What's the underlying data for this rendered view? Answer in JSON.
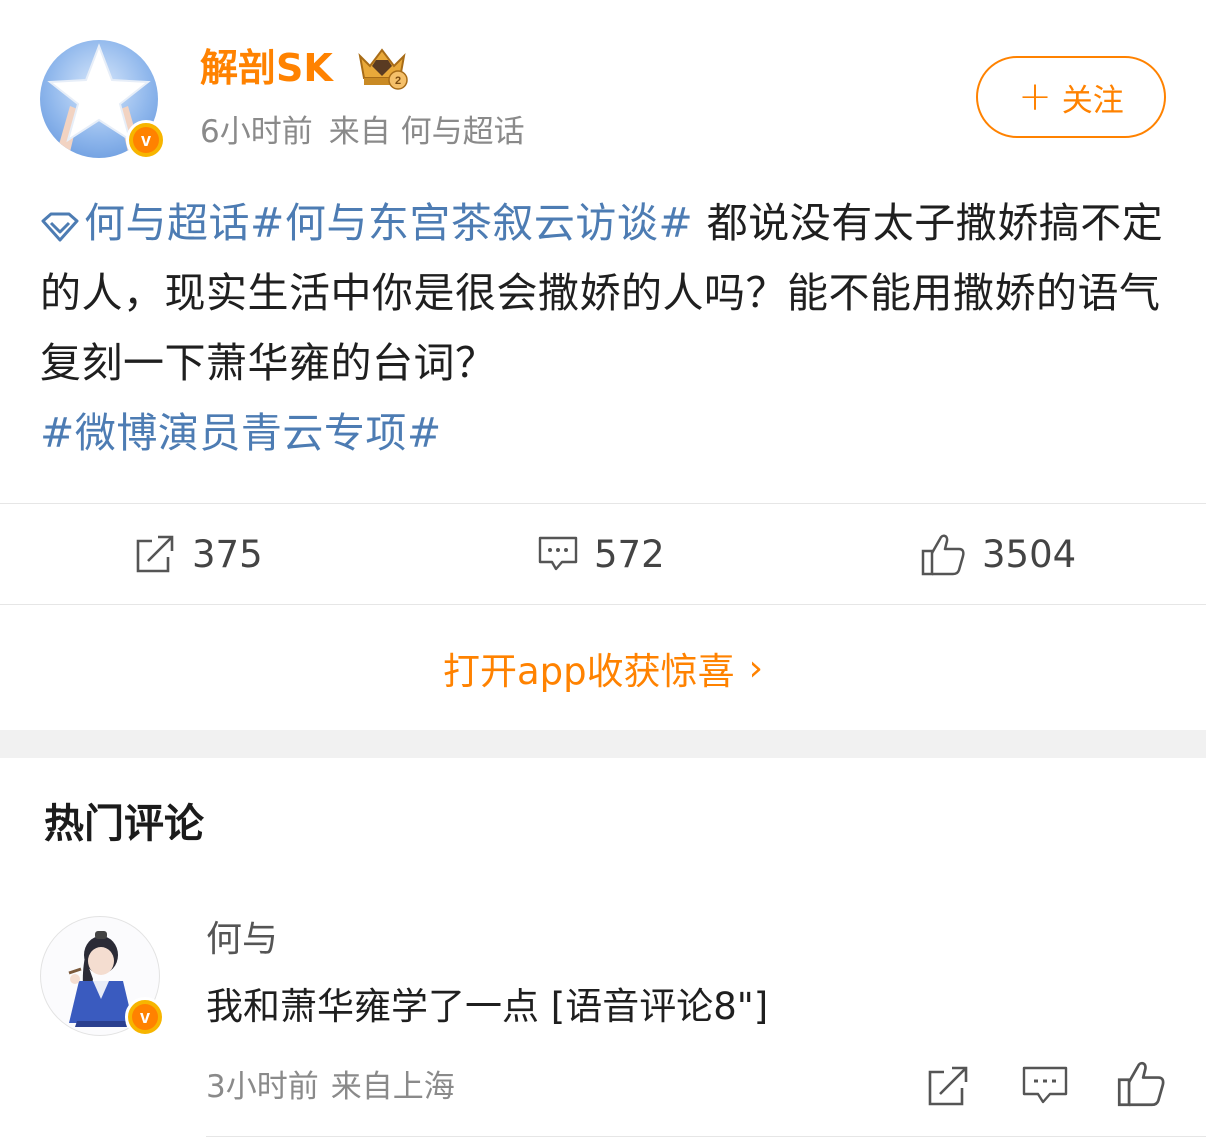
{
  "post": {
    "author": "解剖SK",
    "time": "6小时前",
    "source": "来自 何与超话",
    "follow_label": "关注",
    "supertopic_link": "何与超话",
    "hashtag_1": "#何与东宫茶叙云访谈#",
    "body_1": " 都说没有太子撒娇搞不定的人，现实生活中你是很会撒娇的人吗？能不能用撒娇的语气复刻一下萧华雍的台词？",
    "hashtag_2": "#微博演员青云专项#"
  },
  "actions": {
    "repost_count": "375",
    "comment_count": "572",
    "like_count": "3504"
  },
  "open_app_label": "打开app收获惊喜",
  "comments_section": {
    "title": "热门评论",
    "items": [
      {
        "user": "何与",
        "text": "我和萧华雍学了一点 [语音评论8\"]",
        "time": "3小时前",
        "location": "来自上海"
      }
    ]
  },
  "icons": [
    "star-avatar",
    "verified-v-icon",
    "crown-badge-icon",
    "plus-icon",
    "supertopic-diamond-icon",
    "repost-icon",
    "comment-icon",
    "like-icon",
    "chevron-right-icon"
  ],
  "colors": {
    "accent": "#ff8200",
    "link": "#4d7cb3",
    "muted": "#8a8a8a"
  }
}
